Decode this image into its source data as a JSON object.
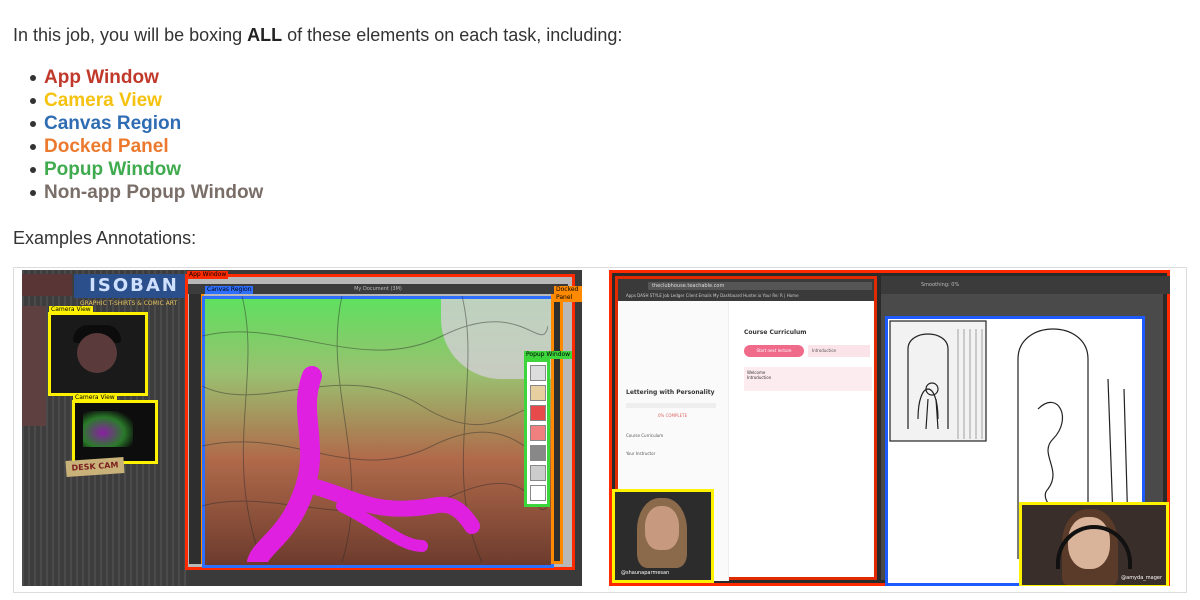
{
  "intro": {
    "prefix": "In this job, you will be boxing ",
    "emphasis": "ALL",
    "suffix": " of these elements on each task, including:"
  },
  "categories": [
    {
      "label": "App Window",
      "color": "#c0392b"
    },
    {
      "label": "Camera View",
      "color": "#f5c20f"
    },
    {
      "label": "Canvas Region",
      "color": "#2f6db3"
    },
    {
      "label": "Docked Panel",
      "color": "#ec7a2e"
    },
    {
      "label": "Popup Window",
      "color": "#3faa4e"
    },
    {
      "label": "Non-app Popup Window",
      "color": "#7a6e68"
    }
  ],
  "examples_heading": "Examples Annotations:",
  "example1": {
    "logo_text": "ISOBAN",
    "tagline": "GRAPHIC T-SHIRTS & COMIC ART",
    "desk_cam": "DESK CAM",
    "labels": {
      "app_window": "App Window",
      "camera_view_1": "Camera View",
      "camera_view_2": "Camera View",
      "canvas_region": "Canvas Region",
      "docked_panel": "Docked Panel",
      "popup_window": "Popup Window"
    },
    "doc_title": "My Document (3M)"
  },
  "example2": {
    "url": "theclubhouse.teachable.com",
    "bookmarks": "Apps  DASH STYLE  Job Ledger  Client Emails  My Dashboard  Hunter.io  Your Re: R | Home",
    "course_title": "Lettering with Personality",
    "percent_complete": "0% COMPLETE",
    "nav_items": [
      "Course Curriculum",
      "Your Instructor"
    ],
    "curriculum_heading": "Course Curriculum",
    "start_button": "Start next lecture",
    "intro_pill": "Introduction",
    "welcome": "Welcome",
    "welcome_item": "Introduction",
    "app_toolbar": "Smoothing: 0%",
    "handle_left": "@shaunaparmesan",
    "handle_right": "@amyda_mager"
  }
}
